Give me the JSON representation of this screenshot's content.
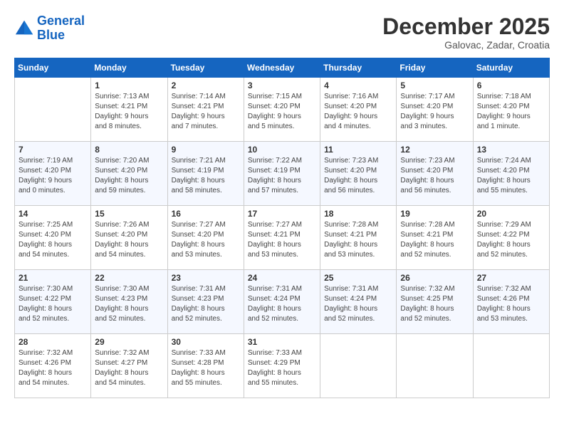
{
  "header": {
    "logo_line1": "General",
    "logo_line2": "Blue",
    "month": "December 2025",
    "location": "Galovac, Zadar, Croatia"
  },
  "weekdays": [
    "Sunday",
    "Monday",
    "Tuesday",
    "Wednesday",
    "Thursday",
    "Friday",
    "Saturday"
  ],
  "weeks": [
    [
      {
        "day": "",
        "info": ""
      },
      {
        "day": "1",
        "info": "Sunrise: 7:13 AM\nSunset: 4:21 PM\nDaylight: 9 hours\nand 8 minutes."
      },
      {
        "day": "2",
        "info": "Sunrise: 7:14 AM\nSunset: 4:21 PM\nDaylight: 9 hours\nand 7 minutes."
      },
      {
        "day": "3",
        "info": "Sunrise: 7:15 AM\nSunset: 4:20 PM\nDaylight: 9 hours\nand 5 minutes."
      },
      {
        "day": "4",
        "info": "Sunrise: 7:16 AM\nSunset: 4:20 PM\nDaylight: 9 hours\nand 4 minutes."
      },
      {
        "day": "5",
        "info": "Sunrise: 7:17 AM\nSunset: 4:20 PM\nDaylight: 9 hours\nand 3 minutes."
      },
      {
        "day": "6",
        "info": "Sunrise: 7:18 AM\nSunset: 4:20 PM\nDaylight: 9 hours\nand 1 minute."
      }
    ],
    [
      {
        "day": "7",
        "info": "Sunrise: 7:19 AM\nSunset: 4:20 PM\nDaylight: 9 hours\nand 0 minutes."
      },
      {
        "day": "8",
        "info": "Sunrise: 7:20 AM\nSunset: 4:20 PM\nDaylight: 8 hours\nand 59 minutes."
      },
      {
        "day": "9",
        "info": "Sunrise: 7:21 AM\nSunset: 4:19 PM\nDaylight: 8 hours\nand 58 minutes."
      },
      {
        "day": "10",
        "info": "Sunrise: 7:22 AM\nSunset: 4:19 PM\nDaylight: 8 hours\nand 57 minutes."
      },
      {
        "day": "11",
        "info": "Sunrise: 7:23 AM\nSunset: 4:20 PM\nDaylight: 8 hours\nand 56 minutes."
      },
      {
        "day": "12",
        "info": "Sunrise: 7:23 AM\nSunset: 4:20 PM\nDaylight: 8 hours\nand 56 minutes."
      },
      {
        "day": "13",
        "info": "Sunrise: 7:24 AM\nSunset: 4:20 PM\nDaylight: 8 hours\nand 55 minutes."
      }
    ],
    [
      {
        "day": "14",
        "info": "Sunrise: 7:25 AM\nSunset: 4:20 PM\nDaylight: 8 hours\nand 54 minutes."
      },
      {
        "day": "15",
        "info": "Sunrise: 7:26 AM\nSunset: 4:20 PM\nDaylight: 8 hours\nand 54 minutes."
      },
      {
        "day": "16",
        "info": "Sunrise: 7:27 AM\nSunset: 4:20 PM\nDaylight: 8 hours\nand 53 minutes."
      },
      {
        "day": "17",
        "info": "Sunrise: 7:27 AM\nSunset: 4:21 PM\nDaylight: 8 hours\nand 53 minutes."
      },
      {
        "day": "18",
        "info": "Sunrise: 7:28 AM\nSunset: 4:21 PM\nDaylight: 8 hours\nand 53 minutes."
      },
      {
        "day": "19",
        "info": "Sunrise: 7:28 AM\nSunset: 4:21 PM\nDaylight: 8 hours\nand 52 minutes."
      },
      {
        "day": "20",
        "info": "Sunrise: 7:29 AM\nSunset: 4:22 PM\nDaylight: 8 hours\nand 52 minutes."
      }
    ],
    [
      {
        "day": "21",
        "info": "Sunrise: 7:30 AM\nSunset: 4:22 PM\nDaylight: 8 hours\nand 52 minutes."
      },
      {
        "day": "22",
        "info": "Sunrise: 7:30 AM\nSunset: 4:23 PM\nDaylight: 8 hours\nand 52 minutes."
      },
      {
        "day": "23",
        "info": "Sunrise: 7:31 AM\nSunset: 4:23 PM\nDaylight: 8 hours\nand 52 minutes."
      },
      {
        "day": "24",
        "info": "Sunrise: 7:31 AM\nSunset: 4:24 PM\nDaylight: 8 hours\nand 52 minutes."
      },
      {
        "day": "25",
        "info": "Sunrise: 7:31 AM\nSunset: 4:24 PM\nDaylight: 8 hours\nand 52 minutes."
      },
      {
        "day": "26",
        "info": "Sunrise: 7:32 AM\nSunset: 4:25 PM\nDaylight: 8 hours\nand 52 minutes."
      },
      {
        "day": "27",
        "info": "Sunrise: 7:32 AM\nSunset: 4:26 PM\nDaylight: 8 hours\nand 53 minutes."
      }
    ],
    [
      {
        "day": "28",
        "info": "Sunrise: 7:32 AM\nSunset: 4:26 PM\nDaylight: 8 hours\nand 54 minutes."
      },
      {
        "day": "29",
        "info": "Sunrise: 7:32 AM\nSunset: 4:27 PM\nDaylight: 8 hours\nand 54 minutes."
      },
      {
        "day": "30",
        "info": "Sunrise: 7:33 AM\nSunset: 4:28 PM\nDaylight: 8 hours\nand 55 minutes."
      },
      {
        "day": "31",
        "info": "Sunrise: 7:33 AM\nSunset: 4:29 PM\nDaylight: 8 hours\nand 55 minutes."
      },
      {
        "day": "",
        "info": ""
      },
      {
        "day": "",
        "info": ""
      },
      {
        "day": "",
        "info": ""
      }
    ]
  ]
}
